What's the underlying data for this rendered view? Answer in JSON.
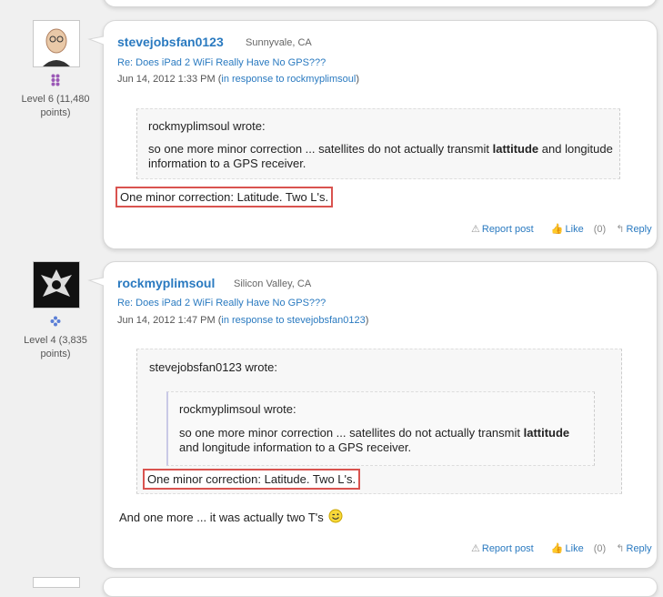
{
  "posts": [
    {
      "username": "stevejobsfan0123",
      "location": "Sunnyvale, CA",
      "level_line1": "Level 6 (11,480",
      "level_line2": "points)",
      "subject": "Re: Does iPad 2 WiFi Really Have No GPS???",
      "date": "Jun 14, 2012 1:33 PM",
      "in_response_prefix": "(",
      "in_response_link": "in response to rockmyplimsoul",
      "in_response_suffix": ")",
      "quote_author": "rockmyplimsoul wrote:",
      "quote_text_before": "so one more minor correction ... satellites do not actually transmit ",
      "quote_bold": "lattitude",
      "quote_text_after": " and longitude information to a GPS receiver.",
      "highlight": "One minor correction: Latitude. Two L's.",
      "report": "Report post",
      "like": "Like",
      "like_count": "(0)",
      "reply": "Reply"
    },
    {
      "username": "rockmyplimsoul",
      "location": "Silicon Valley, CA",
      "level_line1": "Level 4 (3,835",
      "level_line2": "points)",
      "subject": "Re: Does iPad 2 WiFi Really Have No GPS???",
      "date": "Jun 14, 2012 1:47 PM",
      "in_response_prefix": "(",
      "in_response_link": "in response to stevejobsfan0123",
      "in_response_suffix": ")",
      "quote_author": "stevejobsfan0123 wrote:",
      "inner_quote_author": "rockmyplimsoul wrote:",
      "inner_quote_text_before": "so one more minor correction ... satellites do not actually transmit ",
      "inner_quote_bold": "lattitude",
      "inner_quote_text_after": " and longitude information to a GPS receiver.",
      "highlight": "One minor correction: Latitude. Two L's.",
      "body": "And one more ... it was actually two T's",
      "emoji": "wink-emoji",
      "report": "Report post",
      "like": "Like",
      "like_count": "(0)",
      "reply": "Reply"
    }
  ],
  "colors": {
    "link": "#2a7ac0",
    "highlight_border": "#d9534f",
    "level6_badge": "#9b59b6",
    "level4_badge": "#5b7fd6"
  }
}
